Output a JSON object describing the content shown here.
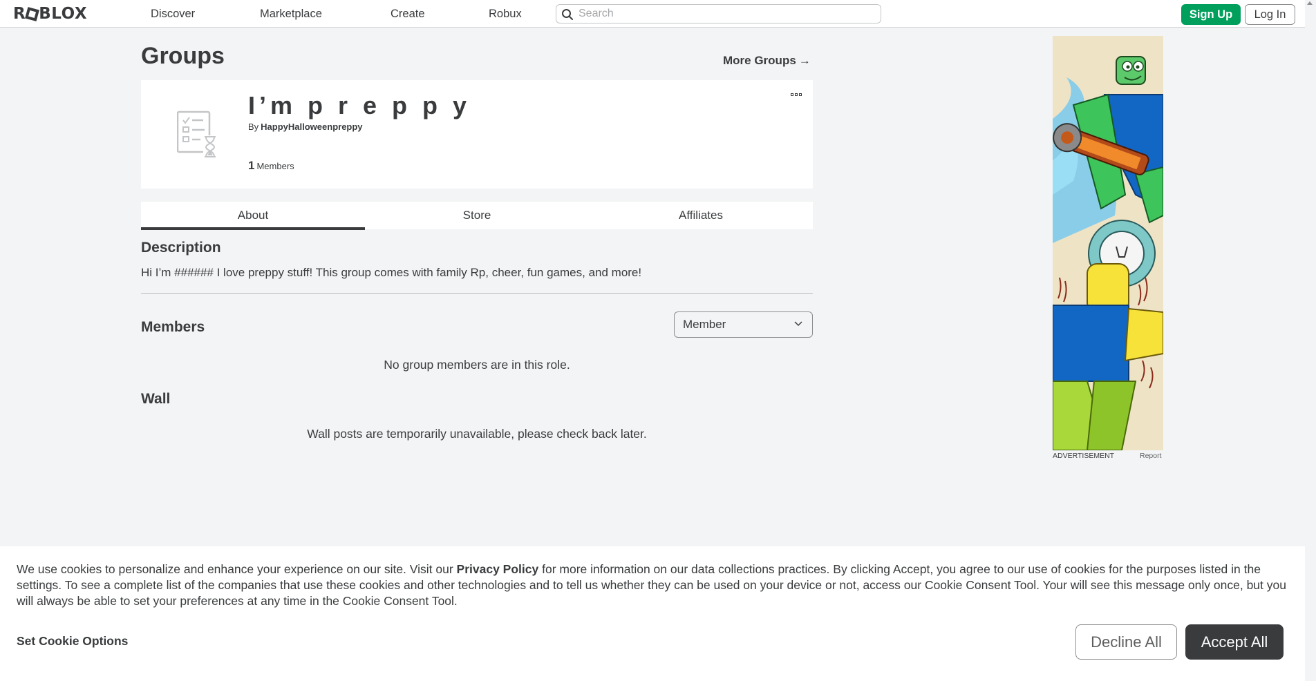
{
  "nav": {
    "logo_text": "ROBLOX",
    "links": [
      "Discover",
      "Marketplace",
      "Create",
      "Robux"
    ],
    "search_placeholder": "Search",
    "signup_label": "Sign Up",
    "login_label": "Log In"
  },
  "page": {
    "title": "Groups",
    "more_groups": "More Groups",
    "more_groups_arrow": "→"
  },
  "group": {
    "name": "I’m p r e p p y",
    "by_label": "By",
    "owner": "HappyHalloweenpreppy",
    "member_count": "1",
    "member_label": "Members"
  },
  "tabs": [
    "About",
    "Store",
    "Affiliates"
  ],
  "description": {
    "title": "Description",
    "text": "Hi I’m ###### I love preppy stuff! This group comes with family Rp, cheer, fun games, and more!"
  },
  "members": {
    "title": "Members",
    "role_selected": "Member",
    "empty_text": "No group members are in this role."
  },
  "wall": {
    "title": "Wall",
    "empty_text": "Wall posts are temporarily unavailable, please check back later."
  },
  "ad": {
    "label": "ADVERTISEMENT",
    "report": "Report"
  },
  "cookie": {
    "text_before": "We use cookies to personalize and enhance your experience on our site. Visit our ",
    "privacy_link": "Privacy Policy",
    "text_after": " for more information on our data collections practices. By clicking Accept, you agree to our use of cookies for the purposes listed in the settings. To see a complete list of the companies that use these cookies and other technologies and to tell us whether they can be used on your device or not, access our Cookie Consent Tool. Your will see this message only once, but you will always be able to set your preferences at any time in the Cookie Consent Tool.",
    "options_label": "Set Cookie Options",
    "decline_label": "Decline All",
    "accept_label": "Accept All"
  },
  "colors": {
    "signup_green": "#00a05c",
    "text_dark": "#393b3d",
    "page_bg": "#f2f4f5"
  }
}
